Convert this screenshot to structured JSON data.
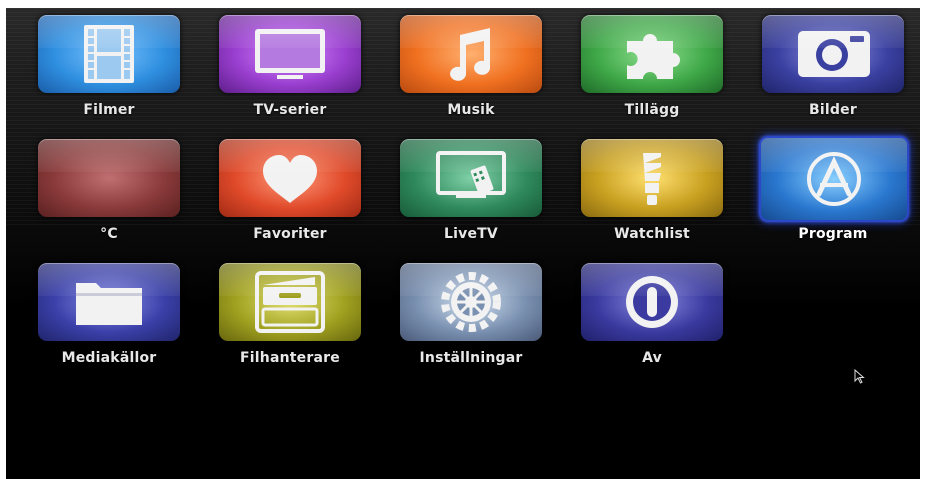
{
  "tiles": [
    {
      "label": "Filmer",
      "icon": "film-strip-icon",
      "color": "#2f8fe0"
    },
    {
      "label": "TV-serier",
      "icon": "tv-icon",
      "color": "#9a3fd0"
    },
    {
      "label": "Musik",
      "icon": "music-note-icon",
      "color": "#f07020"
    },
    {
      "label": "Tillägg",
      "icon": "puzzle-piece-icon",
      "color": "#3fa848"
    },
    {
      "label": "Bilder",
      "icon": "camera-icon",
      "color": "#3a40a0"
    },
    {
      "label": "°C",
      "icon": "weather-icon",
      "color": "#8a3a3a"
    },
    {
      "label": "Favoriter",
      "icon": "heart-icon",
      "color": "#e04a2a"
    },
    {
      "label": "LiveTV",
      "icon": "live-tv-icon",
      "color": "#2f8a5c"
    },
    {
      "label": "Watchlist",
      "icon": "light-bulb-icon",
      "color": "#c8a020"
    },
    {
      "label": "Program",
      "icon": "app-store-icon",
      "color": "#2a78d0",
      "selected": true
    },
    {
      "label": "Mediakällor",
      "icon": "folder-icon",
      "color": "#3a40a8"
    },
    {
      "label": "Filhanterare",
      "icon": "file-box-icon",
      "color": "#a0a020"
    },
    {
      "label": "Inställningar",
      "icon": "gear-icon",
      "color": "#7a90b0"
    },
    {
      "label": "Av",
      "icon": "power-icon",
      "color": "#3a3aa0"
    }
  ]
}
